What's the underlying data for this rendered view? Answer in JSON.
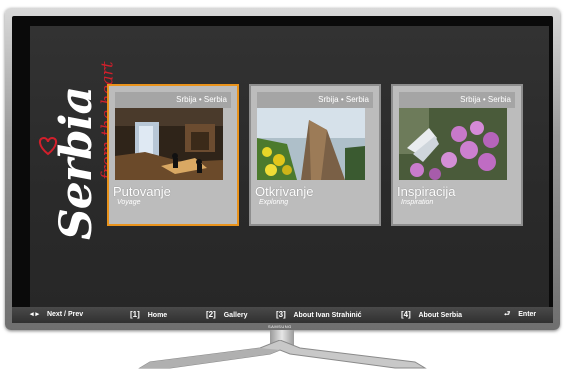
{
  "brand": {
    "wordmark": "Serbia",
    "tagline": "from the heart"
  },
  "cards": [
    {
      "header": "Srbija • Serbia",
      "title": "Putovanje",
      "subtitle": "Voyage",
      "selected": true
    },
    {
      "header": "Srbija • Serbia",
      "title": "Otkrivanje",
      "subtitle": "Exploring",
      "selected": false
    },
    {
      "header": "Srbija • Serbia",
      "title": "Inspiracija",
      "subtitle": "Inspiration",
      "selected": false
    }
  ],
  "bottom_bar": {
    "nav_label": "Next / Prev",
    "home_key": "[1]",
    "home_label": "Home",
    "gallery_key": "[2]",
    "gallery_label": "Gallery",
    "about_author_key": "[3]",
    "about_author_label": "About Ivan Strahinić",
    "about_serbia_key": "[4]",
    "about_serbia_label": "About Serbia",
    "enter_label": "Enter"
  },
  "tv": {
    "brand": "SAMSUNG"
  },
  "colors": {
    "selected_border": "#e9931c",
    "screen_bg": "#2b2b2b",
    "accent_red": "#d21f2b"
  }
}
